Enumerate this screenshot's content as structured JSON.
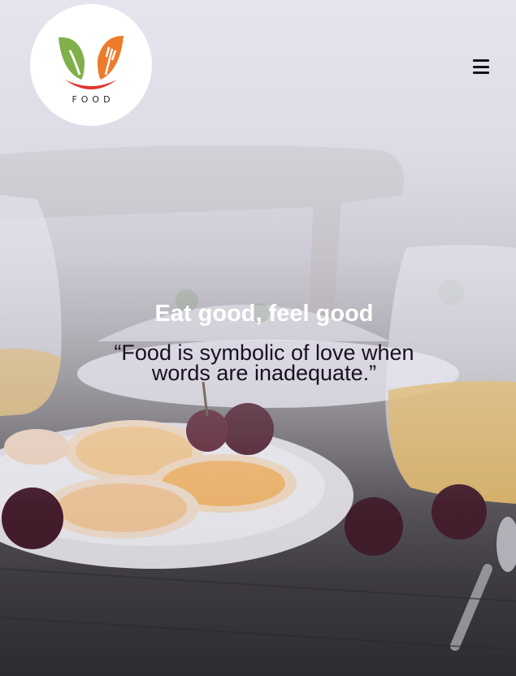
{
  "header": {
    "logo_text": "FOOD",
    "logo_icon": "leaf-fork-smile-logo",
    "menu_icon": "hamburger-menu-icon"
  },
  "hero": {
    "headline": "Eat good, feel good",
    "quote": "“Food is symbolic of love when words are inadequate.”",
    "background_image": "breakfast-table-photo"
  },
  "colors": {
    "logo_green": "#7fb04a",
    "logo_orange": "#ee7b2c",
    "logo_red": "#e0352e",
    "headline": "#ffffff",
    "quote": "#1a0f22",
    "overlay": "#e6e6f2"
  }
}
